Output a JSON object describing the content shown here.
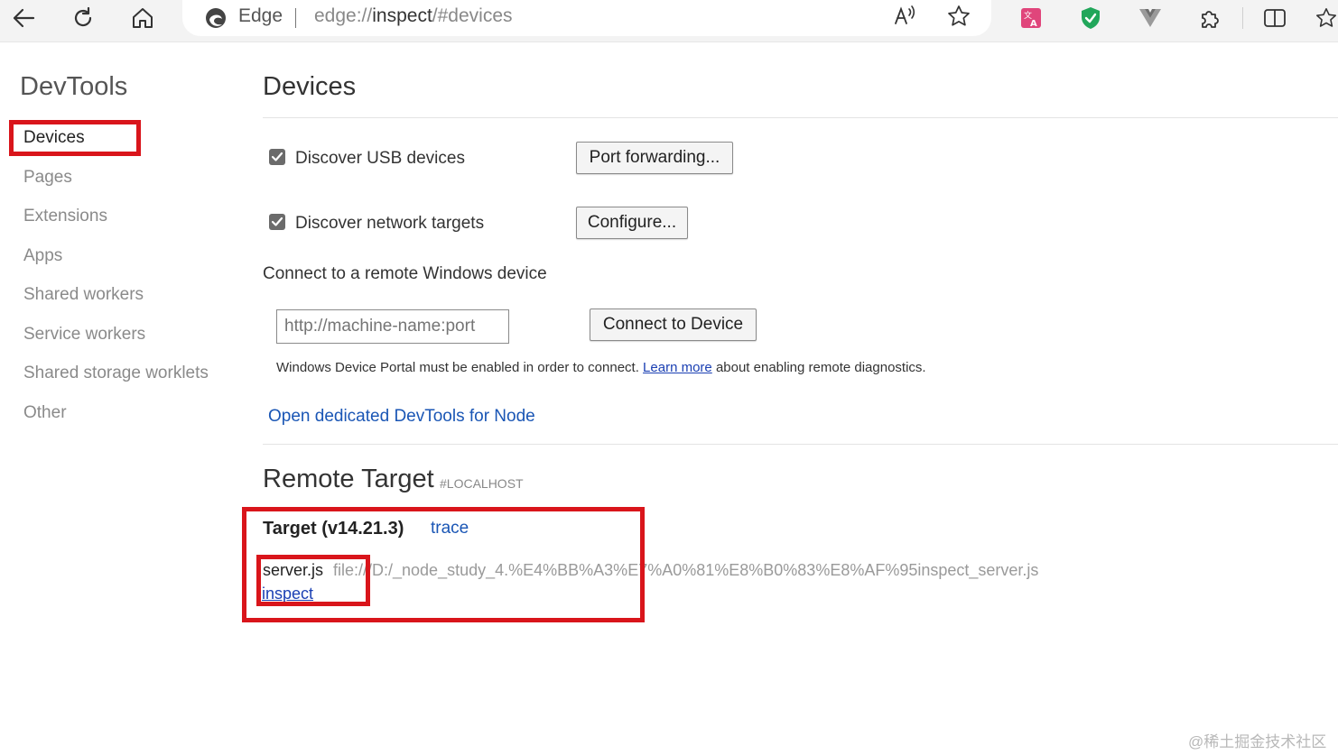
{
  "browser": {
    "brand": "Edge",
    "url_scheme": "edge://",
    "url_host": "inspect",
    "url_path": "/#devices",
    "accent_color": "#d9151b"
  },
  "toolbar_icons": [
    "back-arrow-icon",
    "refresh-icon",
    "home-icon",
    "read-aloud-icon",
    "favorite-star-icon",
    "translate-icon",
    "shield-extension-icon",
    "vue-devtools-icon",
    "extensions-icon",
    "split-screen-icon",
    "favorites-icon"
  ],
  "sidebar": {
    "title": "DevTools",
    "items": [
      {
        "label": "Devices",
        "active": true
      },
      {
        "label": "Pages"
      },
      {
        "label": "Extensions"
      },
      {
        "label": "Apps"
      },
      {
        "label": "Shared workers"
      },
      {
        "label": "Service workers"
      },
      {
        "label": "Shared storage worklets"
      },
      {
        "label": "Other"
      }
    ]
  },
  "devices": {
    "title": "Devices",
    "discover_usb": {
      "label": "Discover USB devices",
      "checked": true
    },
    "port_forwarding_button": "Port forwarding...",
    "discover_network": {
      "label": "Discover network targets",
      "checked": true
    },
    "configure_button": "Configure...",
    "remote_windows_label": "Connect to a remote Windows device",
    "remote_input_placeholder": "http://machine-name:port",
    "connect_button": "Connect to Device",
    "note_prefix": "Windows Device Portal must be enabled in order to connect.",
    "note_link": "Learn more",
    "note_suffix": "about enabling remote diagnostics.",
    "node_devtools_link": "Open dedicated DevTools for Node"
  },
  "remote_target": {
    "title": "Remote Target",
    "tag": "#LOCALHOST",
    "target_name": "Target (v14.21.3)",
    "trace_link": "trace",
    "file_name": "server.js",
    "file_url": "file:///D:/_node_study_4.%E4%BB%A3%E7%A0%81%E8%B0%83%E8%AF%95inspect_server.js",
    "inspect_link": "inspect"
  },
  "watermark": "@稀土掘金技术社区"
}
